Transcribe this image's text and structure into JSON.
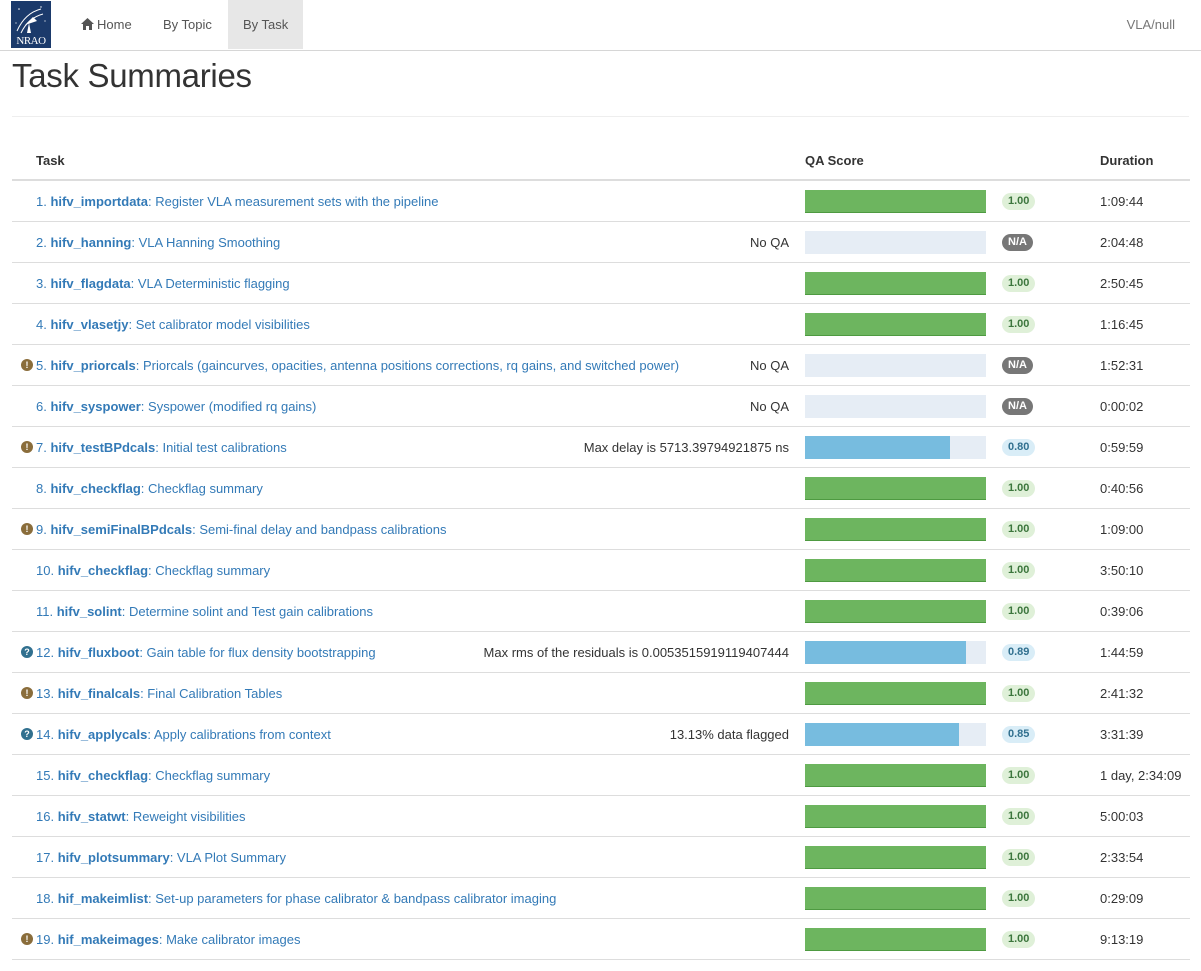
{
  "navbar": {
    "logo_text": "NRAO",
    "home_label": "Home",
    "topic_label": "By Topic",
    "task_label": "By Task",
    "right_text": "VLA/null"
  },
  "page": {
    "title": "Task Summaries"
  },
  "table": {
    "headers": {
      "task": "Task",
      "qa": "QA Score",
      "duration": "Duration"
    },
    "rows": [
      {
        "num": "1.",
        "name": "hifv_importdata",
        "desc": ": Register VLA measurement sets with the pipeline",
        "msg": "",
        "score": "1.00",
        "fill": 1.0,
        "type": "green",
        "warn": "",
        "duration": "1:09:44"
      },
      {
        "num": "2.",
        "name": "hifv_hanning",
        "desc": ": VLA Hanning Smoothing",
        "msg": "No QA",
        "score": "N/A",
        "fill": 0,
        "type": "grey",
        "warn": "",
        "duration": "2:04:48"
      },
      {
        "num": "3.",
        "name": "hifv_flagdata",
        "desc": ": VLA Deterministic flagging",
        "msg": "",
        "score": "1.00",
        "fill": 1.0,
        "type": "green",
        "warn": "",
        "duration": "2:50:45"
      },
      {
        "num": "4.",
        "name": "hifv_vlasetjy",
        "desc": ": Set calibrator model visibilities",
        "msg": "",
        "score": "1.00",
        "fill": 1.0,
        "type": "green",
        "warn": "",
        "duration": "1:16:45"
      },
      {
        "num": "5.",
        "name": "hifv_priorcals",
        "desc": ": Priorcals (gaincurves, opacities, antenna positions corrections, rq gains, and switched power)",
        "msg": "No QA",
        "score": "N/A",
        "fill": 0,
        "type": "grey",
        "warn": "yellow",
        "duration": "1:52:31"
      },
      {
        "num": "6.",
        "name": "hifv_syspower",
        "desc": ": Syspower (modified rq gains)",
        "msg": "No QA",
        "score": "N/A",
        "fill": 0,
        "type": "grey",
        "warn": "",
        "duration": "0:00:02"
      },
      {
        "num": "7.",
        "name": "hifv_testBPdcals",
        "desc": ": Initial test calibrations",
        "msg": "Max delay is 5713.39794921875 ns",
        "score": "0.80",
        "fill": 0.8,
        "type": "blue",
        "warn": "yellow",
        "duration": "0:59:59"
      },
      {
        "num": "8.",
        "name": "hifv_checkflag",
        "desc": ": Checkflag summary",
        "msg": "",
        "score": "1.00",
        "fill": 1.0,
        "type": "green",
        "warn": "",
        "duration": "0:40:56"
      },
      {
        "num": "9.",
        "name": "hifv_semiFinalBPdcals",
        "desc": ": Semi-final delay and bandpass calibrations",
        "msg": "",
        "score": "1.00",
        "fill": 1.0,
        "type": "green",
        "warn": "yellow",
        "duration": "1:09:00"
      },
      {
        "num": "10.",
        "name": "hifv_checkflag",
        "desc": ": Checkflag summary",
        "msg": "",
        "score": "1.00",
        "fill": 1.0,
        "type": "green",
        "warn": "",
        "duration": "3:50:10"
      },
      {
        "num": "11.",
        "name": "hifv_solint",
        "desc": ": Determine solint and Test gain calibrations",
        "msg": "",
        "score": "1.00",
        "fill": 1.0,
        "type": "green",
        "warn": "",
        "duration": "0:39:06"
      },
      {
        "num": "12.",
        "name": "hifv_fluxboot",
        "desc": ": Gain table for flux density bootstrapping",
        "msg": "Max rms of the residuals is 0.0053515919119407444",
        "score": "0.89",
        "fill": 0.89,
        "type": "blue",
        "warn": "blue",
        "duration": "1:44:59"
      },
      {
        "num": "13.",
        "name": "hifv_finalcals",
        "desc": ": Final Calibration Tables",
        "msg": "",
        "score": "1.00",
        "fill": 1.0,
        "type": "green",
        "warn": "yellow",
        "duration": "2:41:32"
      },
      {
        "num": "14.",
        "name": "hifv_applycals",
        "desc": ": Apply calibrations from context",
        "msg": "13.13% data flagged",
        "score": "0.85",
        "fill": 0.85,
        "type": "blue",
        "warn": "blue",
        "duration": "3:31:39"
      },
      {
        "num": "15.",
        "name": "hifv_checkflag",
        "desc": ": Checkflag summary",
        "msg": "",
        "score": "1.00",
        "fill": 1.0,
        "type": "green",
        "warn": "",
        "duration": "1 day, 2:34:09"
      },
      {
        "num": "16.",
        "name": "hifv_statwt",
        "desc": ": Reweight visibilities",
        "msg": "",
        "score": "1.00",
        "fill": 1.0,
        "type": "green",
        "warn": "",
        "duration": "5:00:03"
      },
      {
        "num": "17.",
        "name": "hifv_plotsummary",
        "desc": ": VLA Plot Summary",
        "msg": "",
        "score": "1.00",
        "fill": 1.0,
        "type": "green",
        "warn": "",
        "duration": "2:33:54"
      },
      {
        "num": "18.",
        "name": "hif_makeimlist",
        "desc": ": Set-up parameters for phase calibrator & bandpass calibrator imaging",
        "msg": "",
        "score": "1.00",
        "fill": 1.0,
        "type": "green",
        "warn": "",
        "duration": "0:29:09"
      },
      {
        "num": "19.",
        "name": "hif_makeimages",
        "desc": ": Make calibrator images",
        "msg": "",
        "score": "1.00",
        "fill": 1.0,
        "type": "green",
        "warn": "yellow",
        "duration": "9:13:19"
      }
    ]
  }
}
